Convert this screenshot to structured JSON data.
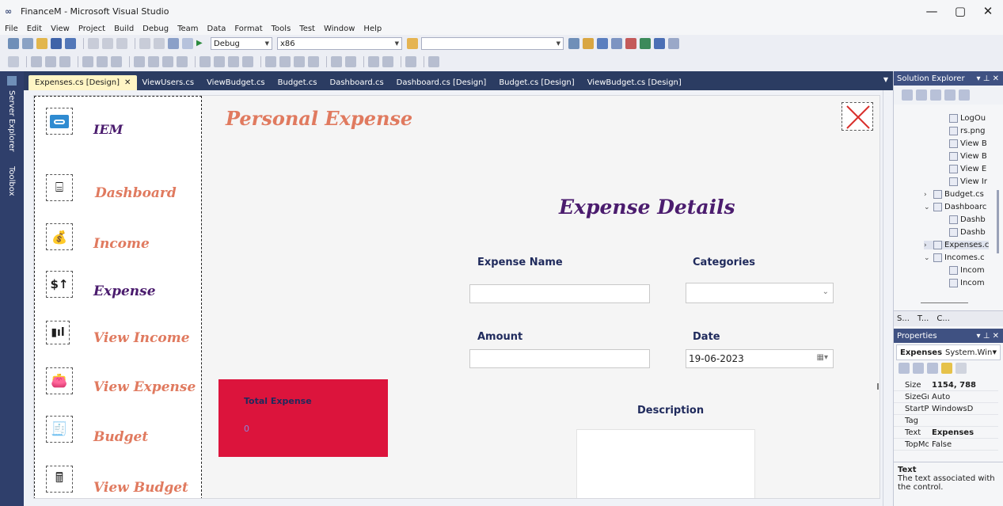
{
  "window": {
    "title": "FinanceM - Microsoft Visual Studio",
    "minimize": "—",
    "maximize": "▢",
    "close": "✕"
  },
  "menu": [
    "File",
    "Edit",
    "View",
    "Project",
    "Build",
    "Debug",
    "Team",
    "Data",
    "Format",
    "Tools",
    "Test",
    "Window",
    "Help"
  ],
  "toolbar": {
    "config": "Debug",
    "platform": "x86"
  },
  "side_strip": {
    "server_explorer": "Server Explorer",
    "toolbox": "Toolbox"
  },
  "tabs": [
    {
      "label": "Expenses.cs [Design]",
      "active": true
    },
    {
      "label": "ViewUsers.cs"
    },
    {
      "label": "ViewBudget.cs"
    },
    {
      "label": "Budget.cs"
    },
    {
      "label": "Dashboard.cs"
    },
    {
      "label": "Dashboard.cs [Design]"
    },
    {
      "label": "Budget.cs [Design]"
    },
    {
      "label": "ViewBudget.cs [Design]"
    }
  ],
  "form": {
    "title": "Personal Expense",
    "app_name": "IEM",
    "nav": [
      {
        "label": "Dashboard",
        "icon": "dashboard-icon"
      },
      {
        "label": "Income",
        "icon": "income-icon"
      },
      {
        "label": "Expense",
        "icon": "expense-icon"
      },
      {
        "label": "View Income",
        "icon": "view-income-icon"
      },
      {
        "label": "View Expense",
        "icon": "view-expense-icon"
      },
      {
        "label": "Budget",
        "icon": "budget-icon"
      },
      {
        "label": "View Budget",
        "icon": "view-budget-icon"
      }
    ],
    "details_title": "Expense Details",
    "expense_name_label": "Expense Name",
    "categories_label": "Categories",
    "amount_label": "Amount",
    "date_label": "Date",
    "date_value": "19-06-2023",
    "description_label": "Description",
    "total_label": "Total Expense",
    "total_value": "0"
  },
  "solution_explorer": {
    "title": "Solution Explorer",
    "items": [
      {
        "label": "LogOu"
      },
      {
        "label": "rs.png"
      },
      {
        "label": "View B"
      },
      {
        "label": "View B"
      },
      {
        "label": "View E"
      },
      {
        "label": "View Ir"
      },
      {
        "label": "Budget.cs"
      },
      {
        "label": "Dashboarc"
      },
      {
        "label": "Dashb"
      },
      {
        "label": "Dashb"
      },
      {
        "label": "Expenses.c"
      },
      {
        "label": "Incomes.c"
      },
      {
        "label": "Incom"
      },
      {
        "label": "Incom"
      }
    ],
    "bottom_tabs": [
      "S...",
      "T...",
      "C..."
    ]
  },
  "properties": {
    "title": "Properties",
    "object_name": "Expenses",
    "object_type": "System.Win",
    "rows": [
      {
        "name": "Size",
        "value": "1154, 788"
      },
      {
        "name": "SizeGrij",
        "value": "Auto"
      },
      {
        "name": "StartPo",
        "value": "WindowsD"
      },
      {
        "name": "Tag",
        "value": ""
      },
      {
        "name": "Text",
        "value": "Expenses"
      },
      {
        "name": "TopMo",
        "value": "False"
      }
    ],
    "desc_title": "Text",
    "desc_text": "The text associated with the control."
  },
  "colors": {
    "accent_coral": "#e07a5f",
    "accent_purple": "#4b1c6e",
    "label_navy": "#1f2a5c",
    "panel_red": "#dc143c",
    "vs_blue": "#2b3c62"
  }
}
